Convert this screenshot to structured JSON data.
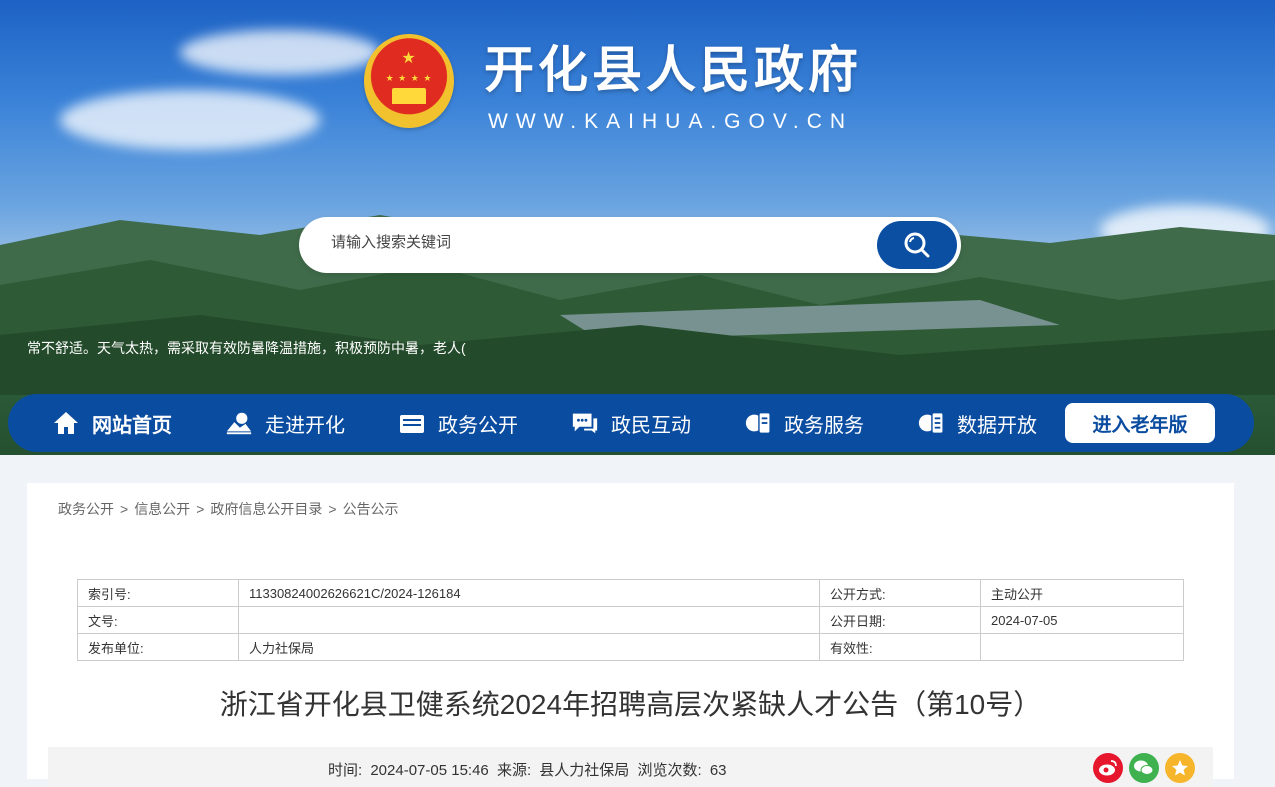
{
  "header": {
    "title": "开化县人民政府",
    "url": "WWW.KAIHUA.GOV.CN",
    "emblem_icon": "national-emblem-icon"
  },
  "search": {
    "placeholder": "请输入搜索关键词",
    "button_icon": "search-icon"
  },
  "marquee": {
    "text": "常不舒适。天气太热，需采取有效防暑降温措施，积极预防中暑，老人("
  },
  "nav": {
    "items": [
      {
        "label": "网站首页",
        "icon": "home-icon"
      },
      {
        "label": "走进开化",
        "icon": "landscape-icon"
      },
      {
        "label": "政务公开",
        "icon": "folder-icon"
      },
      {
        "label": "政民互动",
        "icon": "chat-icon"
      },
      {
        "label": "政务服务",
        "icon": "service-globe-icon"
      },
      {
        "label": "数据开放",
        "icon": "data-globe-icon"
      }
    ],
    "elder_button": "进入老年版"
  },
  "breadcrumb": [
    "政务公开",
    "信息公开",
    "政府信息公开目录",
    "公告公示"
  ],
  "meta_table": {
    "rows": [
      [
        "索引号:",
        "11330824002626621C/2024-126184",
        "公开方式:",
        "主动公开"
      ],
      [
        "文号:",
        "",
        "公开日期:",
        "2024-07-05"
      ],
      [
        "发布单位:",
        "人力社保局",
        "有效性:",
        ""
      ]
    ]
  },
  "article": {
    "title": "浙江省开化县卫健系统2024年招聘高层次紧缺人才公告（第10号）",
    "time_label": "时间:",
    "time_value": "2024-07-05 15:46",
    "source_label": "来源:",
    "source_value": "县人力社保局",
    "views_label": "浏览次数:",
    "views_value": "63"
  },
  "share": {
    "icons": [
      "weibo-icon",
      "wechat-icon",
      "favorite-star-icon"
    ],
    "colors": [
      "#e6162d",
      "#3fb24f",
      "#f7b52c"
    ]
  },
  "colors": {
    "nav_bg": "#0a4ca0",
    "search_button": "#0b4fa3"
  }
}
